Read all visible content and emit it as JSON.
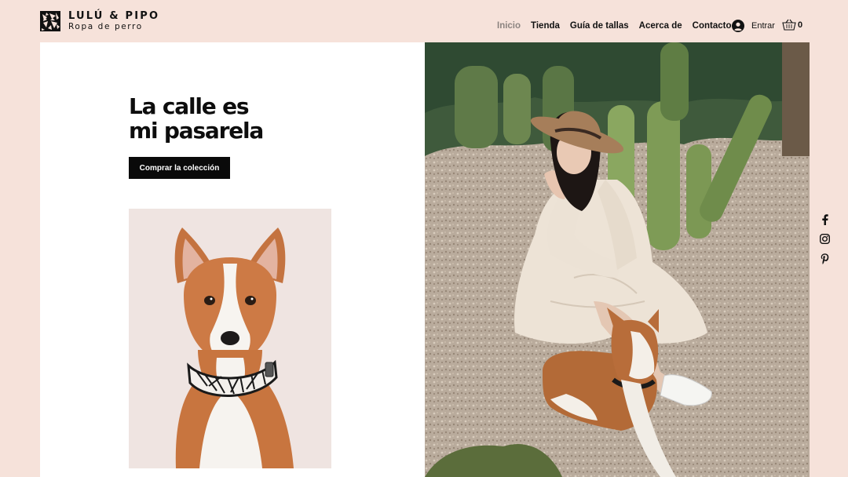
{
  "brand": {
    "name": "LULÚ & PIPO",
    "tagline": "Ropa de perro"
  },
  "nav": {
    "items": [
      {
        "label": "Inicio",
        "active": true
      },
      {
        "label": "Tienda",
        "active": false
      },
      {
        "label": "Guía de tallas",
        "active": false
      },
      {
        "label": "Acerca de",
        "active": false
      },
      {
        "label": "Contacto",
        "active": false
      }
    ]
  },
  "account": {
    "login_label": "Entrar",
    "cart_count": "0"
  },
  "hero": {
    "headline_line1": "La calle es",
    "headline_line2": "mi pasarela",
    "cta_label": "Comprar la colección"
  },
  "social": [
    "facebook-icon",
    "instagram-icon",
    "pinterest-icon"
  ],
  "colors": {
    "background": "#f6e2da",
    "panel": "#ffffff",
    "cta": "#0a0a0a",
    "nav_active": "#8c8480"
  }
}
